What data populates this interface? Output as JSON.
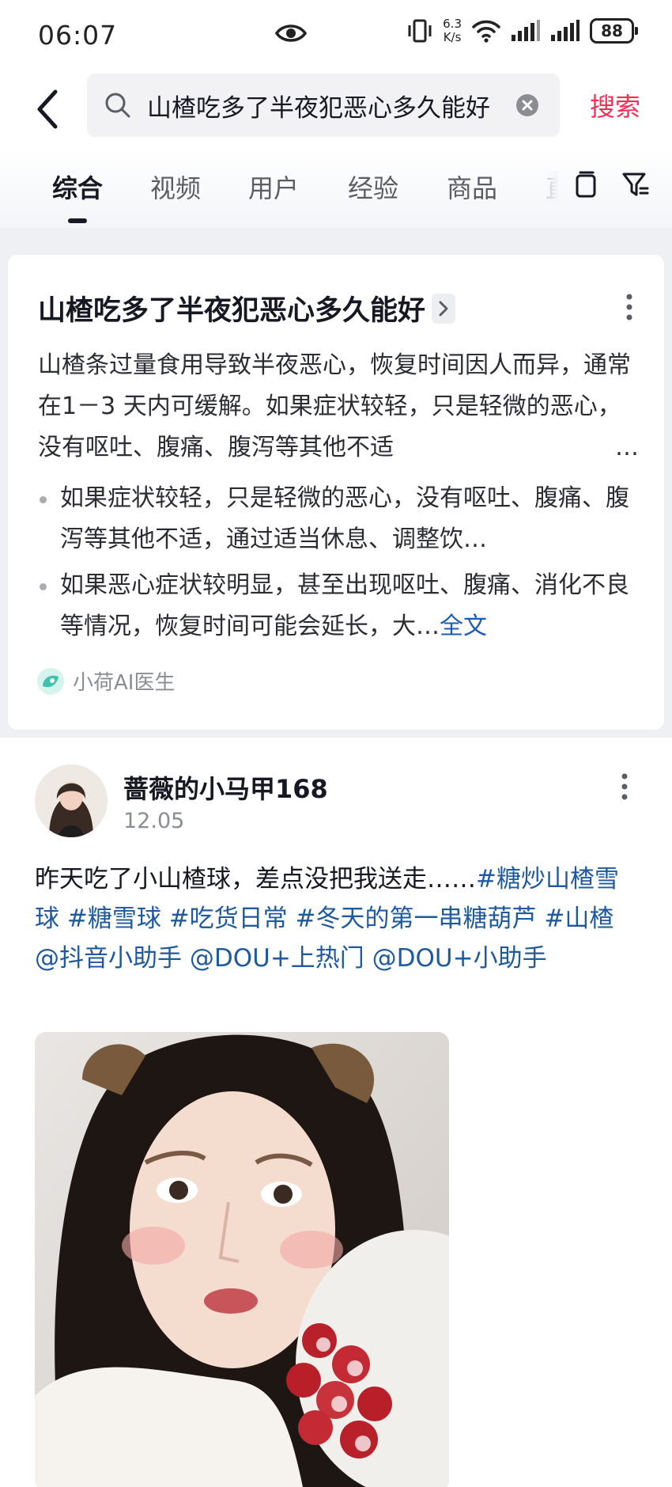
{
  "status_bar": {
    "time": "06:07",
    "net_speed_value": "6.3",
    "net_speed_unit": "K/s",
    "battery": "88"
  },
  "search": {
    "query": "山楂吃多了半夜犯恶心多久能好",
    "submit_label": "搜索"
  },
  "tabs": [
    {
      "label": "综合",
      "active": true
    },
    {
      "label": "视频"
    },
    {
      "label": "用户"
    },
    {
      "label": "经验"
    },
    {
      "label": "商品"
    },
    {
      "label": "直"
    }
  ],
  "ai_card": {
    "title": "山楂吃多了半夜犯恶心多久能好",
    "summary": "山楂条过量食用导致半夜恶心，恢复时间因人而异，通常在1－3 天内可缓解。如果症状较轻，只是轻微的恶心，没有呕吐、腹痛、腹泻等其他不适",
    "summary_ellipsis": "…",
    "bullets": [
      {
        "text": "如果症状较轻，只是轻微的恶心，没有呕吐、腹痛、腹泻等其他不适，通过适当休息、调整饮…"
      },
      {
        "text": "如果恶心症状较明显，甚至出现呕吐、腹痛、消化不良等情况，恢复时间可能会延长，大…",
        "link": "全文"
      }
    ],
    "source": "小荷AI医生"
  },
  "post": {
    "author": "蔷薇的小马甲168",
    "date": "12.05",
    "text_plain": "昨天吃了小山楂球，差点没把我送走……",
    "tags": [
      "#糖炒山楂雪球",
      "#糖雪球",
      "#吃货日常",
      "#冬天的第一串糖葫芦",
      "#山楂",
      "@抖音小助手",
      "@DOU+上热门",
      "@DOU+小助手"
    ]
  },
  "colors": {
    "accent": "#fe2c55",
    "link": "#1f5a9e",
    "text": "#161823"
  }
}
